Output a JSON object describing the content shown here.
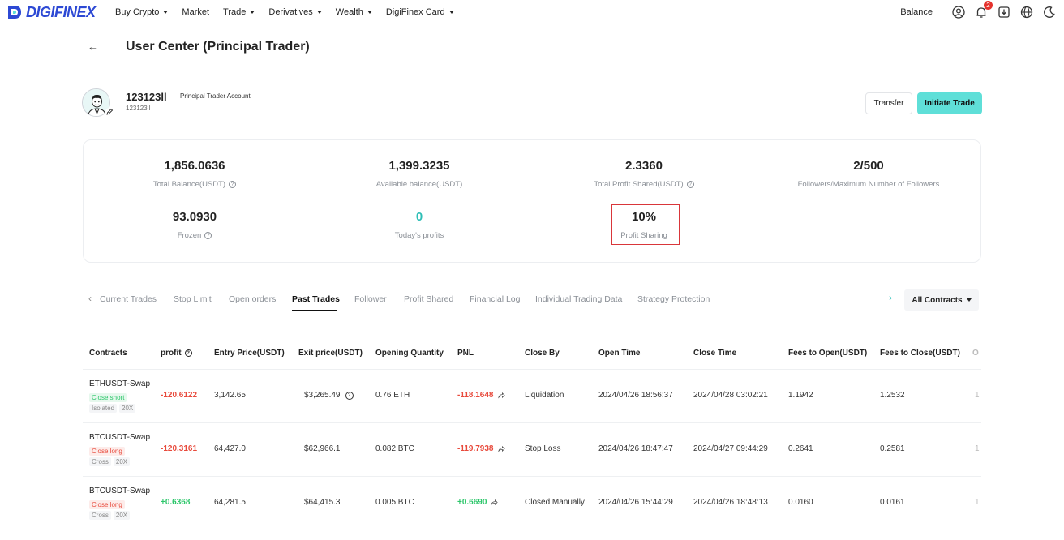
{
  "brand": {
    "name": "DIGIFINEX",
    "color": "#2d49d4"
  },
  "nav": {
    "items": [
      {
        "label": "Buy Crypto",
        "dropdown": true
      },
      {
        "label": "Market",
        "dropdown": false
      },
      {
        "label": "Trade",
        "dropdown": true
      },
      {
        "label": "Derivatives",
        "dropdown": true
      },
      {
        "label": "Wealth",
        "dropdown": true
      },
      {
        "label": "DigiFinex Card",
        "dropdown": true
      }
    ],
    "balance_label": "Balance",
    "notification_count": "2",
    "icons": [
      "user-icon",
      "bell-icon",
      "download-icon",
      "globe-icon",
      "moon-icon"
    ]
  },
  "header": {
    "back": "←",
    "title": "User Center (Principal Trader)"
  },
  "profile": {
    "name": "123123ll",
    "account_type": "Principal Trader Account",
    "id": "123123ll",
    "transfer_label": "Transfer",
    "initiate_label": "Initiate Trade",
    "accent": "#5fdfd8"
  },
  "stats": {
    "total_balance": {
      "value": "1,856.0636",
      "label": "Total Balance(USDT)"
    },
    "available_balance": {
      "value": "1,399.3235",
      "label": "Available balance(USDT)"
    },
    "total_profit_shared": {
      "value": "2.3360",
      "label": "Total Profit Shared(USDT)"
    },
    "followers": {
      "value": "2/500",
      "label": "Followers/Maximum Number of Followers"
    },
    "frozen": {
      "value": "93.0930",
      "label": "Frozen"
    },
    "today_profits": {
      "value": "0",
      "label": "Today's profits"
    },
    "profit_sharing": {
      "value": "10%",
      "label": "Profit Sharing"
    }
  },
  "tabs": {
    "items": [
      "Current Trades",
      "Stop Limit",
      "Open orders",
      "Past Trades",
      "Follower",
      "Profit Shared",
      "Financial Log",
      "Individual Trading Data",
      "Strategy Protection"
    ],
    "active": "Past Trades",
    "filter_label": "All Contracts"
  },
  "table": {
    "columns": [
      "Contracts",
      "profit",
      "Entry Price(USDT)",
      "Exit price(USDT)",
      "Opening Quantity",
      "PNL",
      "Close By",
      "Open Time",
      "Close Time",
      "Fees to Open(USDT)",
      "Fees to Close(USDT)",
      "O"
    ],
    "rows": [
      {
        "contract": "ETHUSDT-Swap",
        "side": "Close short",
        "margin": "Isolated",
        "leverage": "20X",
        "profit": "-120.6122",
        "entry": "3,142.65",
        "exit": "$3,265.49",
        "qty": "0.76 ETH",
        "pnl": "-118.1648",
        "close_by": "Liquidation",
        "open_time": "2024/04/26 18:56:37",
        "close_time": "2024/04/28 03:02:21",
        "fee_open": "1.1942",
        "fee_close": "1.2532",
        "extra": "1"
      },
      {
        "contract": "BTCUSDT-Swap",
        "side": "Close long",
        "margin": "Cross",
        "leverage": "20X",
        "profit": "-120.3161",
        "entry": "64,427.0",
        "exit": "$62,966.1",
        "qty": "0.082 BTC",
        "pnl": "-119.7938",
        "close_by": "Stop Loss",
        "open_time": "2024/04/26 18:47:47",
        "close_time": "2024/04/27 09:44:29",
        "fee_open": "0.2641",
        "fee_close": "0.2581",
        "extra": "1"
      },
      {
        "contract": "BTCUSDT-Swap",
        "side": "Close long",
        "margin": "Cross",
        "leverage": "20X",
        "profit": "+0.6368",
        "entry": "64,281.5",
        "exit": "$64,415.3",
        "qty": "0.005 BTC",
        "pnl": "+0.6690",
        "close_by": "Closed Manually",
        "open_time": "2024/04/26 15:44:29",
        "close_time": "2024/04/26 18:48:13",
        "fee_open": "0.0160",
        "fee_close": "0.0161",
        "extra": "1"
      }
    ]
  }
}
